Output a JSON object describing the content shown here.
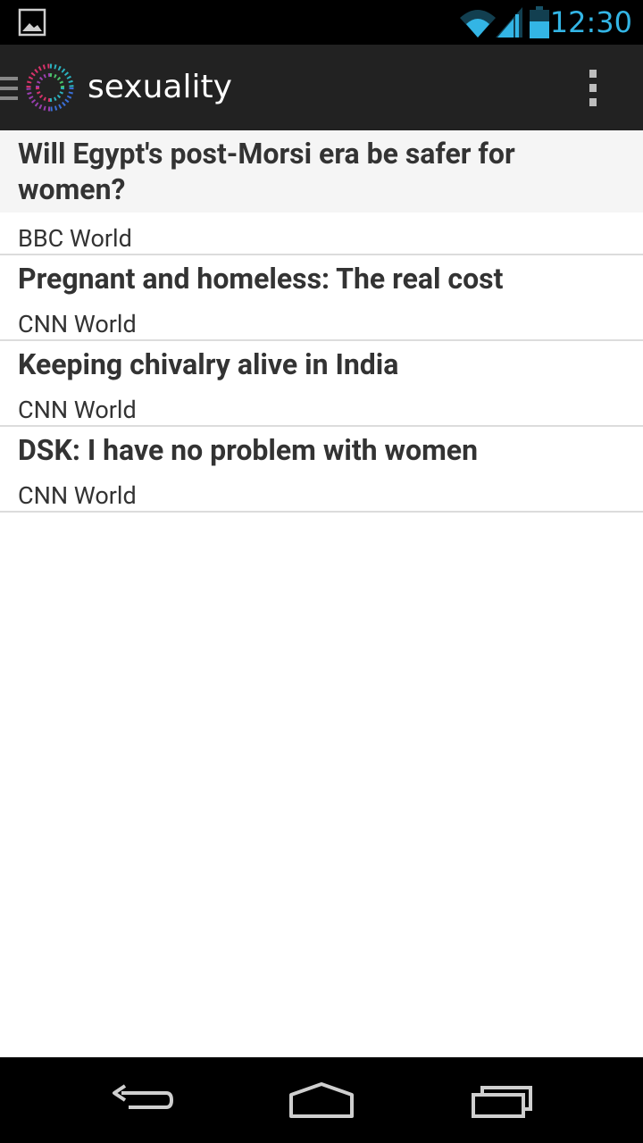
{
  "status_bar": {
    "time": "12:30",
    "accent_color": "#33b5e5",
    "icons": [
      "image-notification-icon",
      "wifi-icon",
      "signal-icon",
      "battery-icon"
    ]
  },
  "action_bar": {
    "title": "sexuality",
    "icons": [
      "drawer-icon",
      "app-logo-icon",
      "overflow-menu-icon"
    ]
  },
  "articles": [
    {
      "headline": "Will Egypt's post-Morsi era be safer for women?",
      "source": "BBC World"
    },
    {
      "headline": "Pregnant and homeless: The real cost",
      "source": "CNN World"
    },
    {
      "headline": "Keeping chivalry alive in India",
      "source": "CNN World"
    },
    {
      "headline": "DSK: I have no problem with women",
      "source": "CNN World"
    }
  ],
  "nav_bar": {
    "icons": [
      "back-icon",
      "home-icon",
      "recent-apps-icon"
    ]
  }
}
